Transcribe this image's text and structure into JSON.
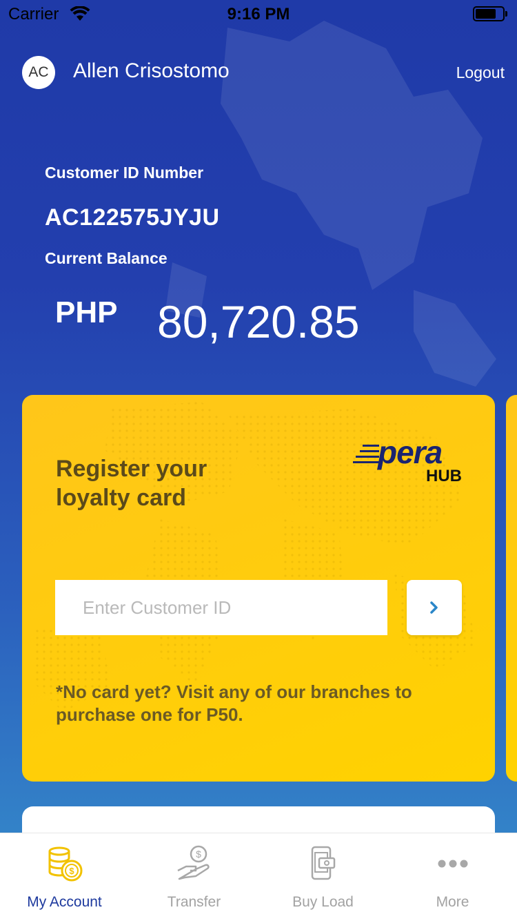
{
  "status_bar": {
    "carrier": "Carrier",
    "time": "9:16 PM"
  },
  "header": {
    "avatar_initials": "AC",
    "user_name": "Allen Crisostomo",
    "logout_label": "Logout"
  },
  "account": {
    "customer_id_label": "Customer ID Number",
    "customer_id": "AC122575JYJU",
    "balance_label": "Current Balance",
    "currency": "PHP",
    "balance": "80,720.85"
  },
  "loyalty_card": {
    "title": "Register your loyalty card",
    "logo_word": "pera",
    "logo_sub": "HUB",
    "input_placeholder": "Enter Customer ID",
    "note": "*No card yet? Visit any of our branches to purchase one for P50."
  },
  "tab_bar": {
    "tabs": [
      {
        "label": "My Account",
        "icon": "coins-icon",
        "active": true
      },
      {
        "label": "Transfer",
        "icon": "money-hand-icon",
        "active": false
      },
      {
        "label": "Buy Load",
        "icon": "phone-load-icon",
        "active": false
      },
      {
        "label": "More",
        "icon": "more-dots-icon",
        "active": false
      }
    ]
  },
  "colors": {
    "accent_blue": "#1e3a9e",
    "card_yellow": "#ffcc0d",
    "inactive_gray": "#a2a2a2"
  }
}
